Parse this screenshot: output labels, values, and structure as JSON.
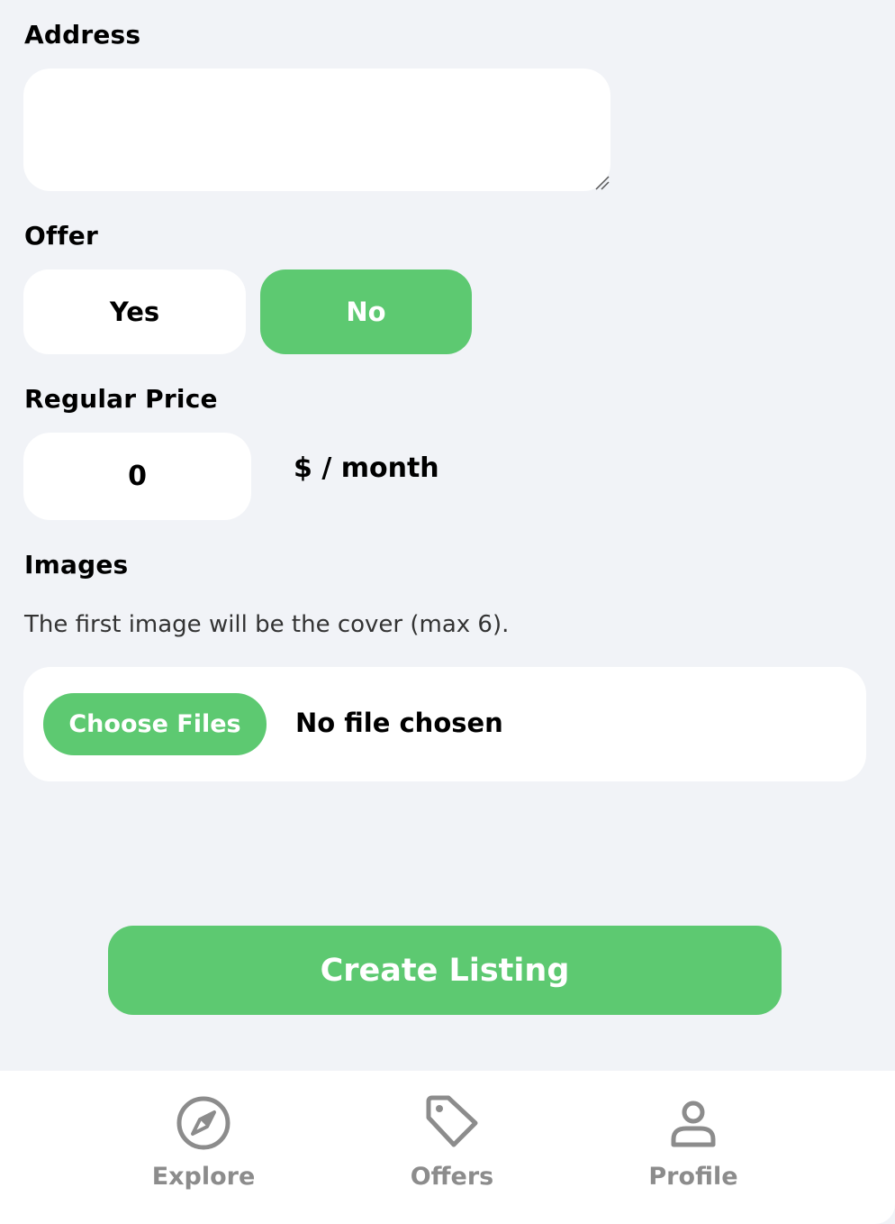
{
  "form": {
    "address": {
      "label": "Address",
      "value": ""
    },
    "offer": {
      "label": "Offer",
      "yes_label": "Yes",
      "no_label": "No",
      "selected": "No"
    },
    "regular_price": {
      "label": "Regular Price",
      "value": "0",
      "unit": "$ / month"
    },
    "images": {
      "label": "Images",
      "hint": "The first image will be the cover (max 6).",
      "choose_label": "Choose Files",
      "status": "No file chosen"
    },
    "submit_label": "Create Listing"
  },
  "nav": {
    "items": [
      {
        "label": "Explore",
        "icon": "compass-icon"
      },
      {
        "label": "Offers",
        "icon": "tag-icon"
      },
      {
        "label": "Profile",
        "icon": "person-icon"
      }
    ]
  },
  "colors": {
    "accent": "#5dc971",
    "background": "#f1f3f7",
    "nav_inactive": "#8c8c8c"
  }
}
